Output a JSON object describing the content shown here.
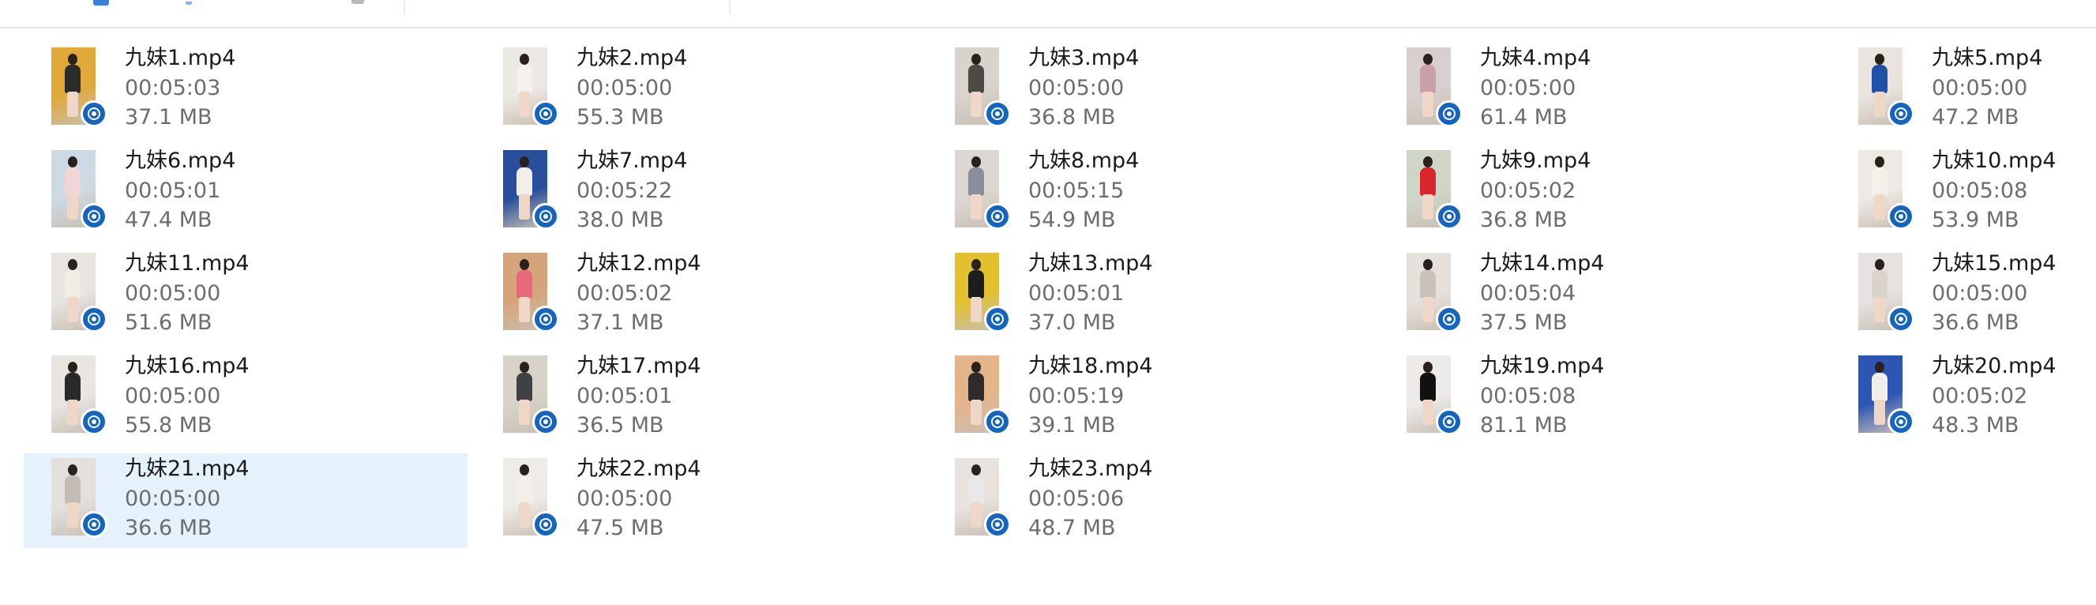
{
  "accent_color": "#1565c0",
  "selection_color": "#e5f1fb",
  "badge_icon": "video-reel-icon",
  "files": [
    {
      "name": "九妹1.mp4",
      "duration": "00:05:03",
      "size": "37.1 MB",
      "selected": false
    },
    {
      "name": "九妹2.mp4",
      "duration": "00:05:00",
      "size": "55.3 MB",
      "selected": false
    },
    {
      "name": "九妹3.mp4",
      "duration": "00:05:00",
      "size": "36.8 MB",
      "selected": false
    },
    {
      "name": "九妹4.mp4",
      "duration": "00:05:00",
      "size": "61.4 MB",
      "selected": false
    },
    {
      "name": "九妹5.mp4",
      "duration": "00:05:00",
      "size": "47.2 MB",
      "selected": false
    },
    {
      "name": "九妹6.mp4",
      "duration": "00:05:01",
      "size": "47.4 MB",
      "selected": false
    },
    {
      "name": "九妹7.mp4",
      "duration": "00:05:22",
      "size": "38.0 MB",
      "selected": false
    },
    {
      "name": "九妹8.mp4",
      "duration": "00:05:15",
      "size": "54.9 MB",
      "selected": false
    },
    {
      "name": "九妹9.mp4",
      "duration": "00:05:02",
      "size": "36.8 MB",
      "selected": false
    },
    {
      "name": "九妹10.mp4",
      "duration": "00:05:08",
      "size": "53.9 MB",
      "selected": false
    },
    {
      "name": "九妹11.mp4",
      "duration": "00:05:00",
      "size": "51.6 MB",
      "selected": false
    },
    {
      "name": "九妹12.mp4",
      "duration": "00:05:02",
      "size": "37.1 MB",
      "selected": false
    },
    {
      "name": "九妹13.mp4",
      "duration": "00:05:01",
      "size": "37.0 MB",
      "selected": false
    },
    {
      "name": "九妹14.mp4",
      "duration": "00:05:04",
      "size": "37.5 MB",
      "selected": false
    },
    {
      "name": "九妹15.mp4",
      "duration": "00:05:00",
      "size": "36.6 MB",
      "selected": false
    },
    {
      "name": "九妹16.mp4",
      "duration": "00:05:00",
      "size": "55.8 MB",
      "selected": false
    },
    {
      "name": "九妹17.mp4",
      "duration": "00:05:01",
      "size": "36.5 MB",
      "selected": false
    },
    {
      "name": "九妹18.mp4",
      "duration": "00:05:19",
      "size": "39.1 MB",
      "selected": false
    },
    {
      "name": "九妹19.mp4",
      "duration": "00:05:08",
      "size": "81.1 MB",
      "selected": false
    },
    {
      "name": "九妹20.mp4",
      "duration": "00:05:02",
      "size": "48.3 MB",
      "selected": false
    },
    {
      "name": "九妹21.mp4",
      "duration": "00:05:00",
      "size": "36.6 MB",
      "selected": true
    },
    {
      "name": "九妹22.mp4",
      "duration": "00:05:00",
      "size": "47.5 MB",
      "selected": false
    },
    {
      "name": "九妹23.mp4",
      "duration": "00:05:06",
      "size": "48.7 MB",
      "selected": false
    }
  ]
}
